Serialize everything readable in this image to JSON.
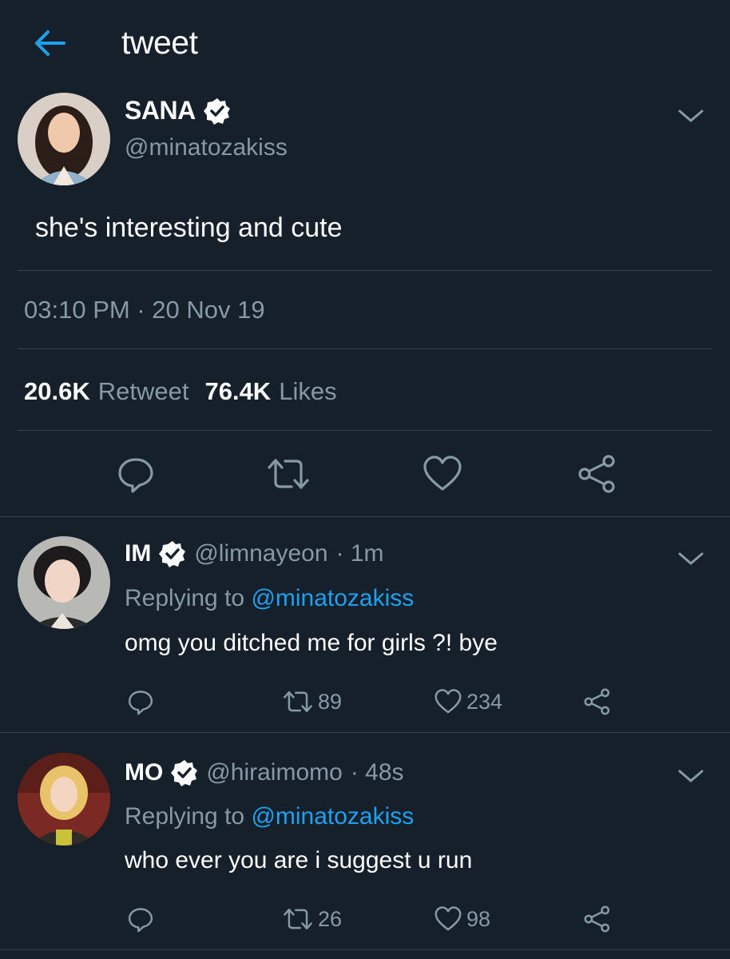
{
  "header": {
    "title": "tweet"
  },
  "colors": {
    "background": "#15202b",
    "accent": "#1da1f2",
    "muted": "#8899a6",
    "divider": "#38444d"
  },
  "main_tweet": {
    "name": "SANA",
    "handle": "@minatozakiss",
    "text": "she's interesting and cute",
    "time": "03:10 PM",
    "separator": "·",
    "date": "20 Nov 19",
    "retweets_count": "20.6K",
    "retweets_label": "Retweet",
    "likes_count": "76.4K",
    "likes_label": "Likes"
  },
  "replies": [
    {
      "name": "IM",
      "handle": "@limnayeon",
      "age": "· 1m",
      "replying_prefix": "Replying to",
      "replying_to": "@minatozakiss",
      "text": "omg you ditched me for girls ?! bye",
      "retweets": "89",
      "likes": "234"
    },
    {
      "name": "MO",
      "handle": "@hiraimomo",
      "age": "· 48s",
      "replying_prefix": "Replying to",
      "replying_to": "@minatozakiss",
      "text": "who ever you are i suggest u run",
      "retweets": "26",
      "likes": "98"
    }
  ]
}
